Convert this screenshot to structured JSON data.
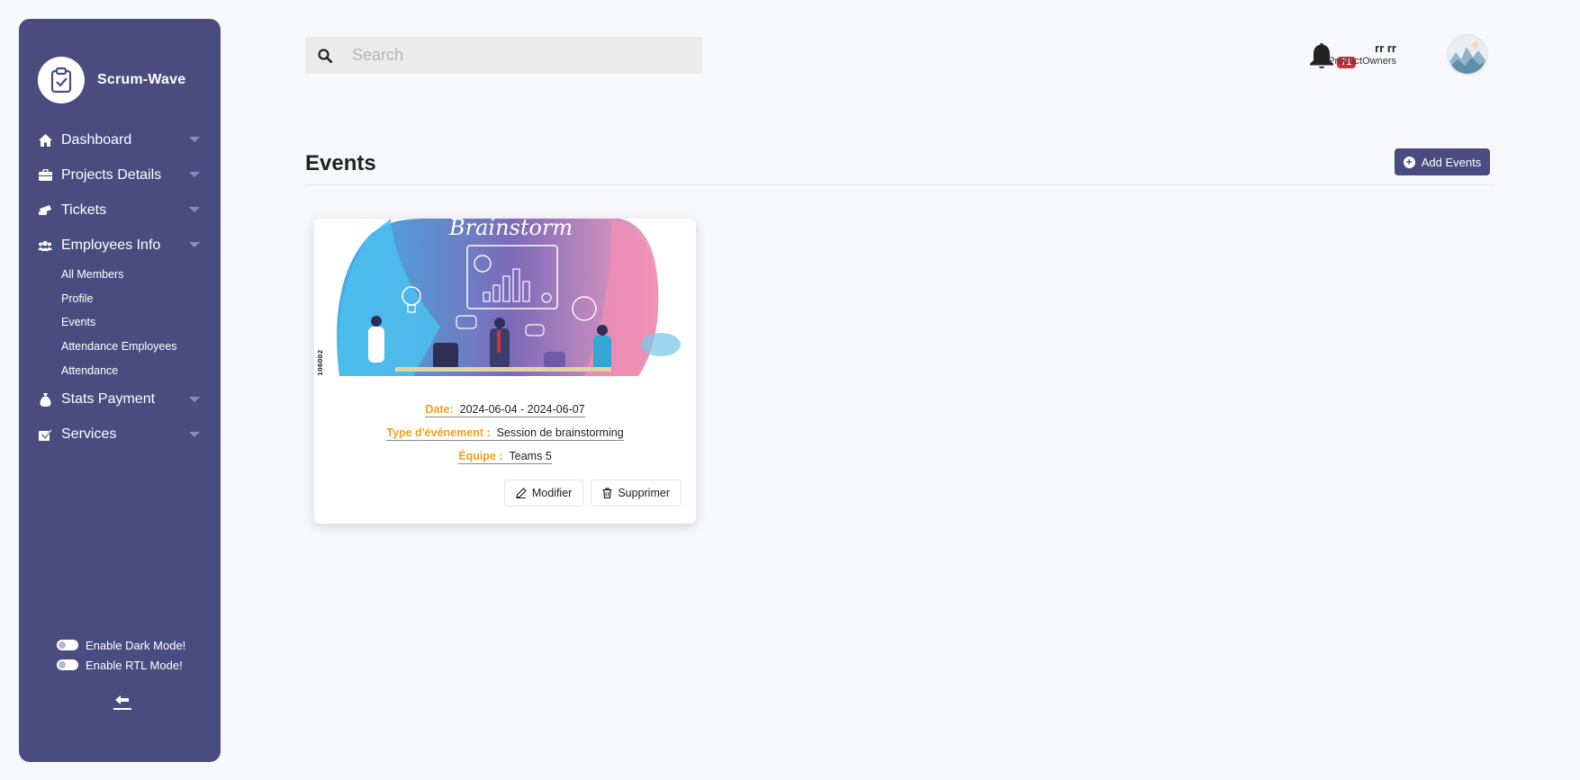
{
  "sidebar": {
    "brand": "Scrum-Wave",
    "items": [
      {
        "label": "Dashboard"
      },
      {
        "label": "Projects Details"
      },
      {
        "label": "Tickets"
      },
      {
        "label": "Employees Info"
      }
    ],
    "employees_sub": [
      "All Members",
      "Profile",
      "Events",
      "Attendance Employees",
      "Attendance"
    ],
    "items_after": [
      {
        "label": "Stats Payment"
      },
      {
        "label": "Services"
      }
    ],
    "dark_mode_label": "Enable Dark Mode!",
    "rtl_mode_label": "Enable RTL Mode!"
  },
  "header": {
    "search_placeholder": "Search",
    "notification_count": "71",
    "user_name": "rr rr",
    "user_role": "ProductOwners"
  },
  "main": {
    "title": "Events",
    "add_button": "Add Events",
    "event": {
      "image_title": "Brainstorm",
      "image_code": "106002",
      "date_label": "Date:",
      "date_value": "2024-06-04 - 2024-06-07",
      "type_label": "Type d'événement :",
      "type_value": "Session de brainstorming",
      "team_label": "Équipe :",
      "team_value": "Teams 5",
      "edit_label": "Modifier",
      "delete_label": "Supprimer"
    }
  },
  "colors": {
    "sidebar_bg": "#4a4c80",
    "accent_label": "#f0a11b",
    "badge": "#d32f3c"
  }
}
